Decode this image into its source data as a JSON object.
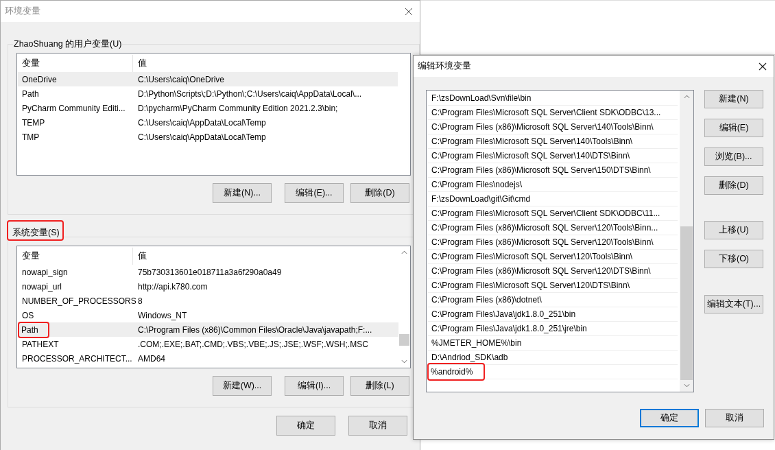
{
  "main_window": {
    "title": "环境变量"
  },
  "user_variables": {
    "label": "ZhaoShuang 的用户变量(U)",
    "highlighted": false,
    "columns": [
      "变量",
      "值"
    ],
    "rows": [
      {
        "name": "OneDrive",
        "value": "C:\\Users\\caiq\\OneDrive",
        "selected": true,
        "highlighted": false
      },
      {
        "name": "Path",
        "value": "D:\\Python\\Scripts\\;D:\\Python\\;C:\\Users\\caiq\\AppData\\Local\\...",
        "selected": false,
        "highlighted": false
      },
      {
        "name": "PyCharm Community Editi...",
        "value": "D:\\pycharm\\PyCharm Community Edition 2021.2.3\\bin;",
        "selected": false,
        "highlighted": false
      },
      {
        "name": "TEMP",
        "value": "C:\\Users\\caiq\\AppData\\Local\\Temp",
        "selected": false,
        "highlighted": false
      },
      {
        "name": "TMP",
        "value": "C:\\Users\\caiq\\AppData\\Local\\Temp",
        "selected": false,
        "highlighted": false
      }
    ],
    "buttons": [
      "新建(N)...",
      "编辑(E)...",
      "删除(D)"
    ]
  },
  "system_variables": {
    "label": "系统变量(S)",
    "highlighted": true,
    "columns": [
      "变量",
      "值"
    ],
    "rows": [
      {
        "name": "nowapi_sign",
        "value": "75b730313601e018711a3a6f290a0a49",
        "selected": false,
        "highlighted": false
      },
      {
        "name": "nowapi_url",
        "value": "http://api.k780.com",
        "selected": false,
        "highlighted": false
      },
      {
        "name": "NUMBER_OF_PROCESSORS",
        "value": "8",
        "selected": false,
        "highlighted": false
      },
      {
        "name": "OS",
        "value": "Windows_NT",
        "selected": false,
        "highlighted": false
      },
      {
        "name": "Path",
        "value": "C:\\Program Files (x86)\\Common Files\\Oracle\\Java\\javapath;F:...",
        "selected": true,
        "highlighted": true
      },
      {
        "name": "PATHEXT",
        "value": ".COM;.EXE;.BAT;.CMD;.VBS;.VBE;.JS;.JSE;.WSF;.WSH;.MSC",
        "selected": false,
        "highlighted": false
      },
      {
        "name": "PROCESSOR_ARCHITECT...",
        "value": "AMD64",
        "selected": false,
        "highlighted": false
      }
    ],
    "buttons": [
      "新建(W)...",
      "编辑(I)...",
      "删除(L)"
    ]
  },
  "dialog_buttons": [
    "确定",
    "取消"
  ],
  "edit_window": {
    "title": "编辑环境变量",
    "entries": [
      {
        "text": "F:\\zsDownLoad\\Svn\\file\\bin",
        "highlighted": false
      },
      {
        "text": "C:\\Program Files\\Microsoft SQL Server\\Client SDK\\ODBC\\13...",
        "highlighted": false
      },
      {
        "text": "C:\\Program Files (x86)\\Microsoft SQL Server\\140\\Tools\\Binn\\",
        "highlighted": false
      },
      {
        "text": "C:\\Program Files\\Microsoft SQL Server\\140\\Tools\\Binn\\",
        "highlighted": false
      },
      {
        "text": "C:\\Program Files\\Microsoft SQL Server\\140\\DTS\\Binn\\",
        "highlighted": false
      },
      {
        "text": "C:\\Program Files (x86)\\Microsoft SQL Server\\150\\DTS\\Binn\\",
        "highlighted": false
      },
      {
        "text": "C:\\Program Files\\nodejs\\",
        "highlighted": false
      },
      {
        "text": "F:\\zsDownLoad\\git\\Git\\cmd",
        "highlighted": false
      },
      {
        "text": "C:\\Program Files\\Microsoft SQL Server\\Client SDK\\ODBC\\11...",
        "highlighted": false
      },
      {
        "text": "C:\\Program Files (x86)\\Microsoft SQL Server\\120\\Tools\\Binn...",
        "highlighted": false
      },
      {
        "text": "C:\\Program Files (x86)\\Microsoft SQL Server\\120\\Tools\\Binn\\",
        "highlighted": false
      },
      {
        "text": "C:\\Program Files\\Microsoft SQL Server\\120\\Tools\\Binn\\",
        "highlighted": false
      },
      {
        "text": "C:\\Program Files (x86)\\Microsoft SQL Server\\120\\DTS\\Binn\\",
        "highlighted": false
      },
      {
        "text": "C:\\Program Files\\Microsoft SQL Server\\120\\DTS\\Binn\\",
        "highlighted": false
      },
      {
        "text": "C:\\Program Files (x86)\\dotnet\\",
        "highlighted": false
      },
      {
        "text": "C:\\Program Files\\Java\\jdk1.8.0_251\\bin",
        "highlighted": false
      },
      {
        "text": "C:\\Program Files\\Java\\jdk1.8.0_251\\jre\\bin",
        "highlighted": false
      },
      {
        "text": "%JMETER_HOME%\\bin",
        "highlighted": false
      },
      {
        "text": "D:\\Andriod_SDK\\adb",
        "highlighted": false
      },
      {
        "text": "%android%",
        "highlighted": true
      }
    ],
    "button_groups": [
      [
        "新建(N)",
        "编辑(E)",
        "浏览(B)...",
        "删除(D)"
      ],
      [
        "上移(U)",
        "下移(O)"
      ],
      [
        "编辑文本(T)..."
      ]
    ],
    "dialog_buttons": [
      {
        "label": "确定",
        "default": true
      },
      {
        "label": "取消",
        "default": false
      }
    ]
  }
}
